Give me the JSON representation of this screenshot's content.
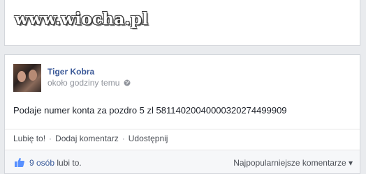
{
  "watermark": {
    "text": "www.wiocha.pl"
  },
  "post": {
    "author": "Tiger Kobra",
    "time": "około godziny temu",
    "privacy_icon": "globe-icon",
    "text": "Podaje numer konta za pozdro 5 zl 58114020040000320274499909"
  },
  "actions": {
    "like": "Lubię to!",
    "comment": "Dodaj komentarz",
    "share": "Udostępnij",
    "separator": "·"
  },
  "likes": {
    "count": "9 osób",
    "suffix": "lubi to.",
    "sort_label": "Najpopularniejsze komentarze",
    "sort_icon": "▾"
  },
  "colors": {
    "link": "#3b5998",
    "background": "#e9ebee",
    "card": "#ffffff"
  }
}
